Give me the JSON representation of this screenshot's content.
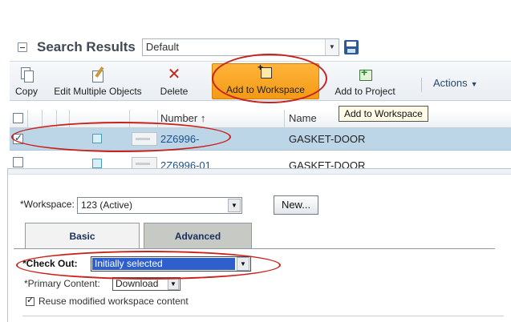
{
  "search": {
    "title": "Search Results",
    "view_value": "Default"
  },
  "toolbar": {
    "copy": "Copy",
    "edit_multiple": "Edit Multiple Objects",
    "delete": "Delete",
    "add_to_workspace": "Add to Workspace",
    "add_to_project": "Add to Project",
    "actions": "Actions",
    "tooltip": "Add to Workspace"
  },
  "grid": {
    "columns": [
      "Number ↑",
      "Name"
    ],
    "rows": [
      {
        "number": "2Z6996-",
        "name": "GASKET-DOOR",
        "checked": true
      },
      {
        "number": "2Z6996-01",
        "name": "GASKET-DOOR",
        "checked": false
      }
    ]
  },
  "dialog": {
    "workspace_label": "*Workspace:",
    "workspace_value": "123 (Active)",
    "new_button": "New...",
    "tabs": [
      "Basic",
      "Advanced"
    ],
    "checkout_label": "*Check Out:",
    "checkout_value": "Initially selected",
    "primary_content_label": "*Primary Content:",
    "primary_content_value": "Download",
    "reuse_label": "Reuse modified workspace content"
  },
  "colors": {
    "accent_orange": "#f39a16",
    "selected_row": "#bcd6e8",
    "annotation_red": "#c8221c",
    "select_highlight": "#2f5fcc"
  }
}
